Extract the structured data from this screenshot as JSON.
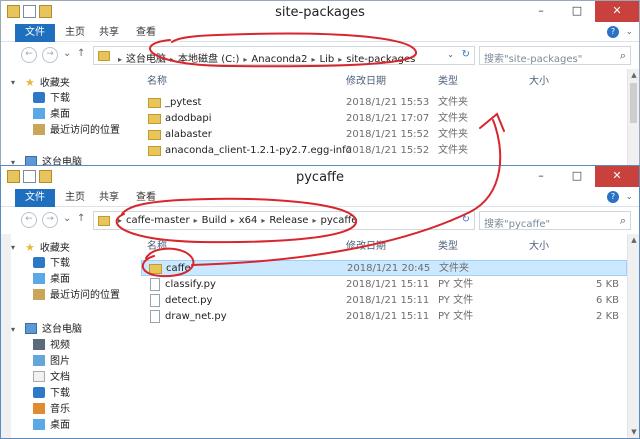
{
  "window_top": {
    "title": "site-packages",
    "ribbon": {
      "file": "文件",
      "home": "主页",
      "share": "共享",
      "view": "查看"
    },
    "breadcrumbs": [
      "这台电脑",
      "本地磁盘 (C:)",
      "Anaconda2",
      "Lib",
      "site-packages"
    ],
    "search_placeholder": "搜索\"site-packages\"",
    "columns": {
      "name": "名称",
      "modified": "修改日期",
      "type": "类型",
      "size": "大小"
    },
    "nav": [
      {
        "label": "收藏夹",
        "icon": "star-icon"
      },
      {
        "label": "下载",
        "icon": "download-folder-icon"
      },
      {
        "label": "桌面",
        "icon": "desktop-folder-icon"
      },
      {
        "label": "最近访问的位置",
        "icon": "recent-places-icon"
      },
      {
        "label": "这台电脑",
        "icon": "computer-icon"
      }
    ],
    "rows": [
      {
        "name": "_pytest",
        "date": "2018/1/21 15:53",
        "type": "文件夹",
        "size": ""
      },
      {
        "name": "adodbapi",
        "date": "2018/1/21 17:07",
        "type": "文件夹",
        "size": ""
      },
      {
        "name": "alabaster",
        "date": "2018/1/21 15:52",
        "type": "文件夹",
        "size": ""
      },
      {
        "name": "anaconda_client-1.2.1-py2.7.egg-info",
        "date": "2018/1/21 15:52",
        "type": "文件夹",
        "size": ""
      }
    ]
  },
  "window_bottom": {
    "title": "pycaffe",
    "ribbon": {
      "file": "文件",
      "home": "主页",
      "share": "共享",
      "view": "查看"
    },
    "breadcrumbs": [
      "caffe-master",
      "Build",
      "x64",
      "Release",
      "pycaffe"
    ],
    "search_placeholder": "搜索\"pycaffe\"",
    "columns": {
      "name": "名称",
      "modified": "修改日期",
      "type": "类型",
      "size": "大小"
    },
    "nav": [
      {
        "label": "收藏夹",
        "icon": "star-icon"
      },
      {
        "label": "下载",
        "icon": "download-folder-icon"
      },
      {
        "label": "桌面",
        "icon": "desktop-folder-icon"
      },
      {
        "label": "最近访问的位置",
        "icon": "recent-places-icon"
      },
      {
        "label": "这台电脑",
        "icon": "computer-icon"
      },
      {
        "label": "视频",
        "icon": "videos-folder-icon"
      },
      {
        "label": "图片",
        "icon": "pictures-folder-icon"
      },
      {
        "label": "文档",
        "icon": "documents-folder-icon"
      },
      {
        "label": "下载",
        "icon": "download-folder-icon"
      },
      {
        "label": "音乐",
        "icon": "music-folder-icon"
      },
      {
        "label": "桌面",
        "icon": "desktop-folder-icon"
      }
    ],
    "rows": [
      {
        "name": "caffe",
        "date": "2018/1/21 20:45",
        "type": "文件夹",
        "size": ""
      },
      {
        "name": "classify.py",
        "date": "2018/1/21 15:11",
        "type": "PY 文件",
        "size": "5 KB"
      },
      {
        "name": "detect.py",
        "date": "2018/1/21 15:11",
        "type": "PY 文件",
        "size": "6 KB"
      },
      {
        "name": "draw_net.py",
        "date": "2018/1/21 15:11",
        "type": "PY 文件",
        "size": "2 KB"
      }
    ]
  },
  "annotation_color": "#d8262c"
}
